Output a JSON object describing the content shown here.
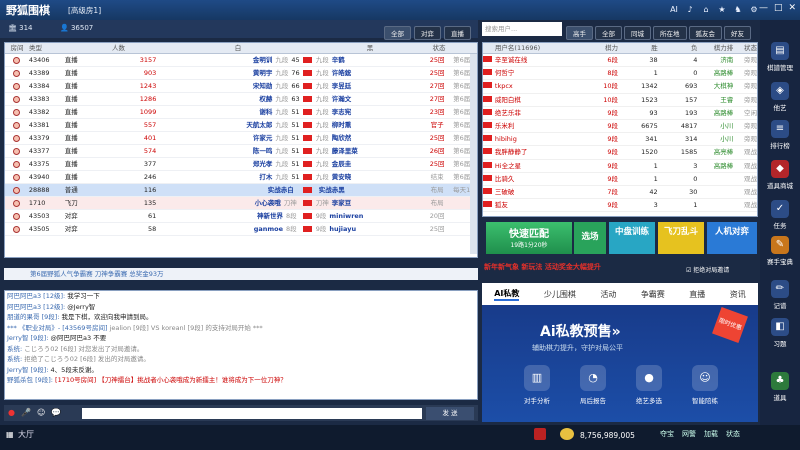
{
  "window": {
    "logo": "野狐围棋",
    "room_title": "[高级房1]",
    "controls": [
      "—",
      "□",
      "✕"
    ],
    "top_icons": [
      "AI",
      "♪",
      "⌂",
      "★",
      "♞",
      "⚙"
    ]
  },
  "info": {
    "rooms": "314",
    "users": "36507",
    "tabs": [
      "全部",
      "对弈",
      "直播"
    ]
  },
  "room_headers": [
    "房间",
    "类型",
    "人数",
    "白",
    "黑",
    "状态",
    ""
  ],
  "rooms": [
    {
      "id": "43406",
      "type": "直播",
      "count": "3157",
      "white": "金明训",
      "wrank": "九段",
      "wnum": "45",
      "black": "辛鹤",
      "brank": "九段",
      "status": "25回",
      "extra": "第6届梦"
    },
    {
      "id": "43389",
      "type": "直播",
      "count": "903",
      "white": "黄明宇",
      "wrank": "九段",
      "wnum": "76",
      "black": "许皓鋐",
      "brank": "九段",
      "status": "25回",
      "extra": "第6届梦"
    },
    {
      "id": "43384",
      "type": "直播",
      "count": "1243",
      "white": "宋知勋",
      "wrank": "九段",
      "wnum": "66",
      "black": "李昱廷",
      "brank": "九段",
      "status": "27回",
      "extra": "第6届梦"
    },
    {
      "id": "43383",
      "type": "直播",
      "count": "1286",
      "white": "权赫",
      "wrank": "九段",
      "wnum": "63",
      "black": "许瀚文",
      "brank": "九段",
      "status": "27回",
      "extra": "第6届梦"
    },
    {
      "id": "43382",
      "type": "直播",
      "count": "1099",
      "white": "谢科",
      "wrank": "九段",
      "wnum": "51",
      "black": "李志宪",
      "brank": "九段",
      "status": "23回",
      "extra": "第6届梦"
    },
    {
      "id": "43381",
      "type": "直播",
      "count": "557",
      "white": "天航太郎",
      "wrank": "九段",
      "wnum": "51",
      "black": "柳时熏",
      "brank": "九段",
      "status": "官子",
      "extra": "第6届梦"
    },
    {
      "id": "43379",
      "type": "直播",
      "count": "401",
      "white": "许家元",
      "wrank": "九段",
      "wnum": "51",
      "black": "陶欣然",
      "brank": "九段",
      "status": "25回",
      "extra": "第6届梦"
    },
    {
      "id": "43377",
      "type": "直播",
      "count": "574",
      "white": "陈一鸣",
      "wrank": "九段",
      "wnum": "51",
      "black": "藤泽里菜",
      "brank": "九段",
      "status": "26回",
      "extra": "第6届梦"
    },
    {
      "id": "43375",
      "type": "直播",
      "count": "377",
      "white": "郑光孝",
      "wrank": "九段",
      "wnum": "51",
      "black": "金辰圭",
      "brank": "九段",
      "status": "25回",
      "extra": "第6届梦"
    },
    {
      "id": "43940",
      "type": "直播",
      "count": "246",
      "white": "打木",
      "wrank": "九段",
      "wnum": "51",
      "black": "黄安晓",
      "brank": "九段",
      "status": "结束",
      "extra": "第6届梦"
    },
    {
      "id": "28888",
      "type": "普通",
      "count": "116",
      "white": "实战赤白",
      "wrank": "",
      "wnum": "",
      "black": "实战赤黑",
      "brank": "",
      "status": "布局",
      "extra": "每天10"
    },
    {
      "id": "1710",
      "type": "飞刀",
      "count": "135",
      "white": "小心袭哦",
      "wrank": "刀神",
      "wnum": "",
      "black": "李家豆",
      "brank": "刀神",
      "status": "布局",
      "extra": ""
    },
    {
      "id": "43503",
      "type": "对弈",
      "count": "61",
      "white": "神新世界",
      "wrank": "8段",
      "wnum": "",
      "black": "miniwren",
      "brank": "9段",
      "status": "20回",
      "extra": ""
    },
    {
      "id": "43505",
      "type": "对弈",
      "count": "58",
      "white": "ganmoe",
      "wrank": "8段",
      "wnum": "",
      "black": "hujiayu",
      "brank": "9段",
      "status": "25回",
      "extra": ""
    }
  ],
  "broadcast": "第6届野狐人气争霸赛 刀神争霸赛 总奖金93万",
  "chat": [
    {
      "name": "阿巴阿巴a3 [12级]:",
      "text": "我学习一下",
      "cls": ""
    },
    {
      "name": "阿巴阿巴a3 [12级]:",
      "text": "@Jerry智",
      "cls": ""
    },
    {
      "name": "朋道的果哥 [9段]:",
      "text": "我是下棋，欢迎向我申請到局。",
      "cls": ""
    },
    {
      "name": "*** 《职业对局》- [43569号房间]",
      "text": "jealion [9段] VS koreanl [9段] 的支持对局开始 ***",
      "cls": "s"
    },
    {
      "name": "Jerry智 [9段]:",
      "text": "@阿巴阿巴a3 不要",
      "cls": ""
    },
    {
      "name": "系统:",
      "text": "こじろう02 [6段] 对您发出了对局邀请。",
      "cls": "s"
    },
    {
      "name": "系统:",
      "text": "拒绝了こじろう02 [6段] 发出的对局邀请。",
      "cls": "s"
    },
    {
      "name": "Jerry智 [9段]:",
      "text": "4、5段未反谢。",
      "cls": ""
    },
    {
      "name": "野狐杀包 [9段]:",
      "text": "[1710号房间] 【刀神擂台】挑战者小心袭哦成为新擂主！谁将成为下一位刀神？",
      "cls": "r"
    }
  ],
  "chat_send": "发 送",
  "search_placeholder": "搜索用户...",
  "right_tabs": [
    "高手",
    "全部",
    "同城",
    "所在地",
    "狐友会",
    "好友"
  ],
  "user_headers": [
    "",
    "用户名(11696)",
    "棋力",
    "胜",
    "负",
    "棋力排",
    "状态"
  ],
  "users": [
    {
      "name": "辛至诚在线",
      "rank": "6段",
      "w": "38",
      "l": "4",
      "place": "济南",
      "st": "旁观"
    },
    {
      "name": "何哲宁",
      "rank": "8段",
      "w": "1",
      "l": "0",
      "place": "高路棒",
      "st": "旁观"
    },
    {
      "name": "tkpcx",
      "rank": "10段",
      "w": "1342",
      "l": "693",
      "place": "大棋神",
      "st": "旁观"
    },
    {
      "name": "威阳白棋",
      "rank": "10段",
      "w": "1523",
      "l": "157",
      "place": "王睿",
      "st": "旁观"
    },
    {
      "name": "绝艺乐菲",
      "rank": "9段",
      "w": "93",
      "l": "193",
      "place": "高路棒",
      "st": "空闲"
    },
    {
      "name": "乐米利",
      "rank": "9段",
      "w": "6675",
      "l": "4817",
      "place": "小川",
      "st": "旁观"
    },
    {
      "name": "hibihig",
      "rank": "9段",
      "w": "341",
      "l": "314",
      "place": "小川",
      "st": "旁观"
    },
    {
      "name": "我胖静静了",
      "rank": "9段",
      "w": "1520",
      "l": "1585",
      "place": "高亮棒",
      "st": "观战"
    },
    {
      "name": "Hi全之星",
      "rank": "9段",
      "w": "1",
      "l": "3",
      "place": "高路棒",
      "st": "观战"
    },
    {
      "name": "比骑久",
      "rank": "9段",
      "w": "1",
      "l": "0",
      "place": "",
      "st": "观战"
    },
    {
      "name": "三破破",
      "rank": "7段",
      "w": "42",
      "l": "30",
      "place": "",
      "st": "观战"
    },
    {
      "name": "狐友",
      "rank": "9段",
      "w": "3",
      "l": "1",
      "place": "",
      "st": "观战"
    }
  ],
  "quick_match": {
    "title": "快速匹配",
    "sub": "19路1分20秒"
  },
  "game_buttons": [
    {
      "label": "选场",
      "color": "#29a35b"
    },
    {
      "label": "中盘训练",
      "color": "#28a6c4"
    },
    {
      "label": "飞刀乱斗",
      "color": "#e6c21f"
    },
    {
      "label": "人机对弈",
      "color": "#2a7ad6"
    }
  ],
  "promo": "新年新气象  新玩法  活动奖金大幅提升",
  "reject_invite": "拒绝对局邀请",
  "ad_tabs": [
    "AI私教",
    "少儿围棋",
    "活动",
    "争霸赛",
    "直播",
    "资讯"
  ],
  "ad": {
    "title": "Ai私教预售»",
    "subtitle": "辅助棋力提升，守护对局公平",
    "badge": "限时优惠",
    "features": [
      "对手分析",
      "局后报告",
      "绝艺多选",
      "智能陪练"
    ]
  },
  "sidebar": [
    "棋譜管理",
    "他艺",
    "排行榜",
    "道具商城",
    "任务",
    "赛手宝典",
    "记谱",
    "习题",
    "道具"
  ],
  "bottom": {
    "hall": "大厅",
    "gold": "8,756,989,005",
    "items": [
      "夺宝",
      "网警",
      "加载",
      "状态"
    ]
  }
}
